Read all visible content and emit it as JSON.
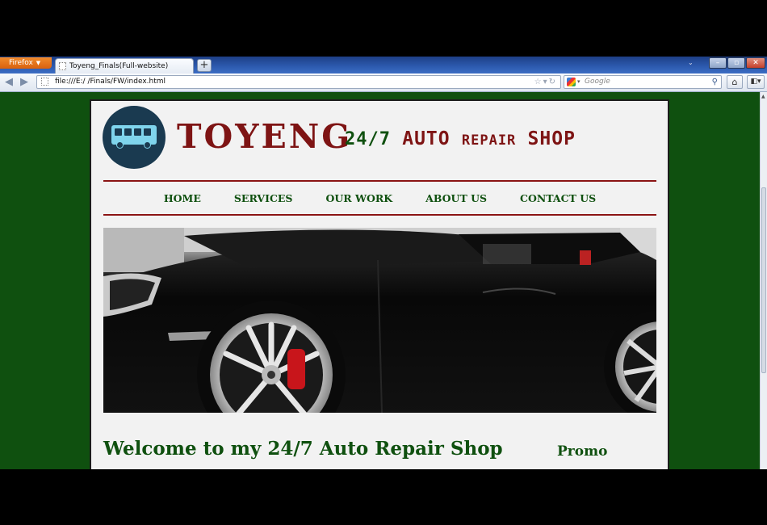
{
  "browser": {
    "menu_label": "Firefox",
    "tab_title": "Toyeng_Finals(Full-website)",
    "new_tab": "+",
    "url": "file:///E:/ /Finals/FW/index.html",
    "search_placeholder": "Google",
    "icons": [
      "back-icon",
      "forward-icon",
      "bookmark-star-icon",
      "reload-icon",
      "google-icon",
      "search-icon",
      "home-icon",
      "addon-icon",
      "minimize-icon",
      "maximize-icon",
      "close-icon"
    ]
  },
  "site": {
    "brand": "TOYENG",
    "tagline_num": "24/7",
    "tagline_auto": "AUTO",
    "tagline_repair": "REPAIR",
    "tagline_shop": "SHOP",
    "nav": [
      "HOME",
      "SERVICES",
      "OUR WORK",
      "ABOUT US",
      "CONTACT US"
    ],
    "welcome_heading": "Welcome to my 24/7 Auto Repair Shop",
    "promo_heading": "Promo"
  },
  "colors": {
    "page_bg": "#0f500f",
    "accent_red": "#7e1414",
    "text_green": "#0f500f",
    "container_bg": "#f2f2f2"
  }
}
